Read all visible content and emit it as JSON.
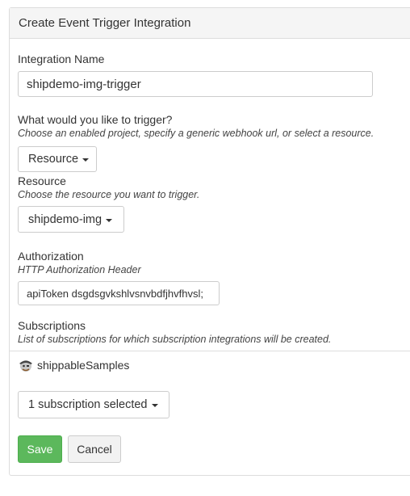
{
  "panel": {
    "title": "Create Event Trigger Integration"
  },
  "integration_name": {
    "label": "Integration Name",
    "value": "shipdemo-img-trigger"
  },
  "trigger": {
    "label": "What would you like to trigger?",
    "help": "Choose an enabled project, specify a generic webhook url, or select a resource.",
    "selected": "Resource"
  },
  "resource": {
    "label": "Resource",
    "help": "Choose the resource you want to trigger.",
    "selected": "shipdemo-img"
  },
  "authorization": {
    "label": "Authorization",
    "help": "HTTP Authorization Header",
    "value": "apiToken dsgdsgvkshlvsnvbdfjhvfhvsl;"
  },
  "subscriptions": {
    "label": "Subscriptions",
    "help": "List of subscriptions for which subscription integrations will be created.",
    "org_name": "shippableSamples",
    "org_icon": "pirate-avatar-icon",
    "selected": "1 subscription selected"
  },
  "actions": {
    "save": "Save",
    "cancel": "Cancel"
  },
  "colors": {
    "save_bg": "#5cb85c",
    "heading_bg": "#f5f5f5",
    "border": "#dddddd"
  }
}
